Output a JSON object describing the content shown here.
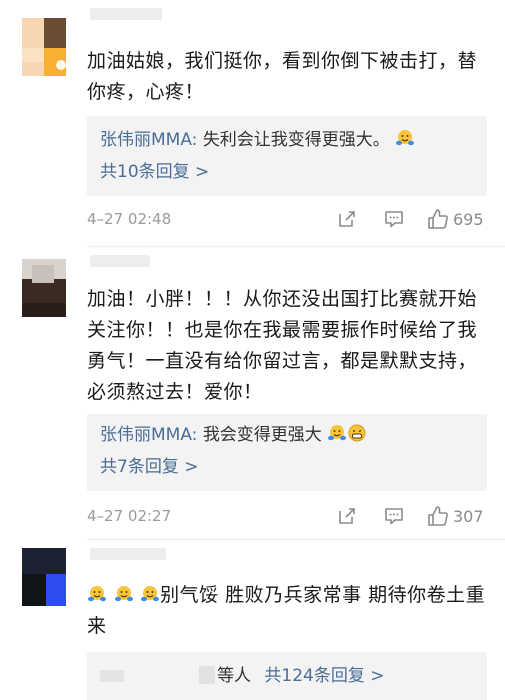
{
  "comments": [
    {
      "body": "加油姑娘，我们挺你，看到你倒下被击打，替你疼，心疼！",
      "reply": {
        "author": "张伟丽MMA:",
        "text": "失利会让我变得更强大。",
        "emoji": [
          "hug-emoji"
        ]
      },
      "more": "共10条回复 >",
      "time": "4–27 02:48",
      "likes": "695"
    },
    {
      "body": "加油！小胖！！！从你还没出国打比赛就开始关注你！！也是你在我最需要振作时候给了我勇气！一直没有给你留过言，都是默默支持，必须熬过去！爱你！",
      "reply": {
        "author": "张伟丽MMA:",
        "text": "我会变得更强大",
        "emoji": [
          "hug-emoji",
          "grin-emoji"
        ]
      },
      "more": "共7条回复 >",
      "time": "4–27 02:27",
      "likes": "307"
    },
    {
      "body": "别气馁 胜败乃兵家常事 期待你卷土重来",
      "body_emoji": [
        "hug-emoji",
        "hug-emoji",
        "hug-emoji"
      ],
      "reply_partial": "等人",
      "more": "共124条回复 >"
    }
  ],
  "colors": {
    "link": "#4a6d96",
    "reply_bg": "#f3f3f3",
    "meta": "#9a9a9a"
  }
}
